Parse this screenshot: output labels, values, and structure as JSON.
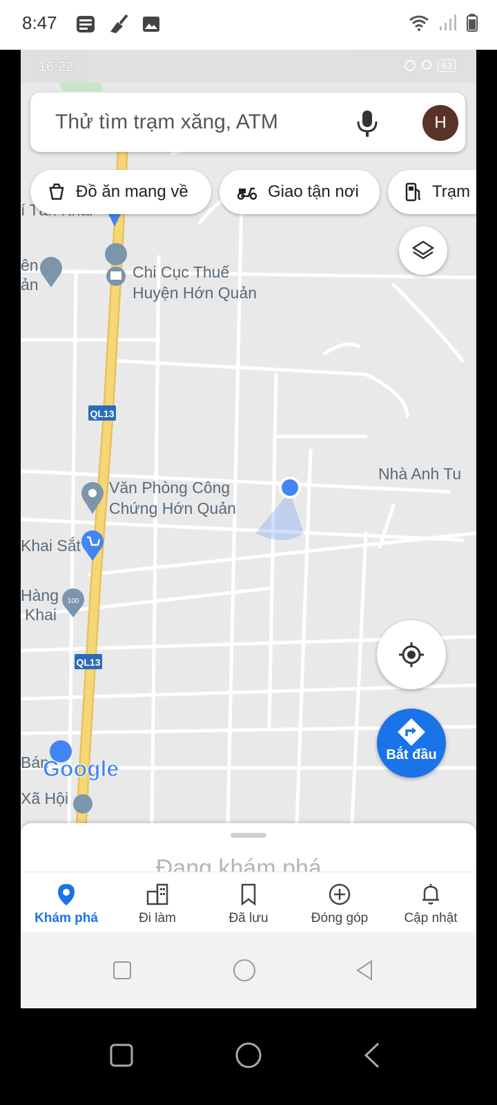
{
  "device_status": {
    "time": "8:47"
  },
  "inner_status": {
    "time": "16:22",
    "battery": "63"
  },
  "search": {
    "placeholder": "Thử tìm trạm xăng, ATM",
    "avatar_letter": "H"
  },
  "chips": [
    {
      "label": "Đồ ăn mang về",
      "icon": "takeout-icon"
    },
    {
      "label": "Giao tận nơi",
      "icon": "delivery-scooter-icon"
    },
    {
      "label": "Trạm",
      "icon": "gas-station-icon"
    }
  ],
  "map": {
    "labels": {
      "tan_khai": "í Tân Khai",
      "chi_cuc_1": "Chi Cục Thuế",
      "chi_cuc_2": "Huyện Hớn Quản",
      "ql13_a": "QL13",
      "ql13_b": "QL13",
      "van_phong_1": "Văn Phòng Công",
      "van_phong_2": "Chứng Hớn Quản",
      "nha_anh_tu": "Nhà Anh Tu",
      "khai_sat": "Khai Sắt",
      "hang_1": "Hàng",
      "hang_2": "Khai",
      "ven": "ên",
      "an": "ản",
      "ban": "Bán",
      "xa_hoi": "Xã Hội",
      "google": "Google"
    }
  },
  "start_button": {
    "label": "Bắt đầu"
  },
  "sheet": {
    "text": "Đang khám phá..."
  },
  "tabs": [
    {
      "label": "Khám phá",
      "active": true
    },
    {
      "label": "Đi làm"
    },
    {
      "label": "Đã lưu"
    },
    {
      "label": "Đóng góp"
    },
    {
      "label": "Cập nhật"
    }
  ],
  "colors": {
    "accent": "#1a73e8",
    "highway": "#f6d675",
    "road": "#ffffff",
    "map_bg": "#e9e9ea",
    "avatar": "#5b3326"
  }
}
